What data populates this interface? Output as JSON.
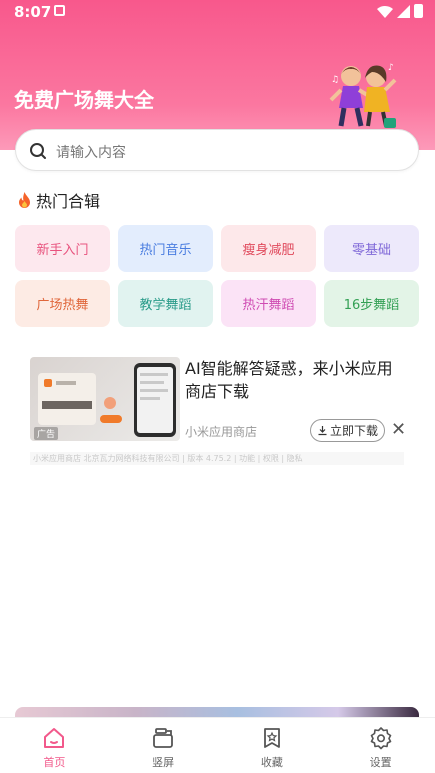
{
  "status_bar": {
    "time": "8:07"
  },
  "header": {
    "title": "免费广场舞大全"
  },
  "search": {
    "placeholder": "请输入内容"
  },
  "hot_section": {
    "title": "热门合辑"
  },
  "categories": [
    {
      "label": "新手入门",
      "bg": "#fde8ee",
      "fg": "#e8537e"
    },
    {
      "label": "热门音乐",
      "bg": "#e3edfd",
      "fg": "#4a7de0"
    },
    {
      "label": "瘦身减肥",
      "bg": "#fde8ea",
      "fg": "#e0495c"
    },
    {
      "label": "零基础",
      "bg": "#ede9fb",
      "fg": "#8069d8"
    },
    {
      "label": "广场热舞",
      "bg": "#fdebe4",
      "fg": "#e0673c"
    },
    {
      "label": "教学舞蹈",
      "bg": "#e1f3f0",
      "fg": "#2b9c8a"
    },
    {
      "label": "热汗舞蹈",
      "bg": "#fbe3f6",
      "fg": "#cf4cb3"
    },
    {
      "label": "16步舞蹈",
      "bg": "#e3f4e7",
      "fg": "#34a055"
    }
  ],
  "ad": {
    "title": "AI智能解答疑惑，来小米应用商店下载",
    "source": "小米应用商店",
    "download_label": "立即下载",
    "close_symbol": "✕",
    "thumb_badge": "广告",
    "footer": "小米应用商店 北京瓦力网络科技有限公司 | 版本 4.75.2 | 功能 | 权限 | 隐私"
  },
  "bottom_nav": [
    {
      "label": "首页",
      "icon": "home-icon",
      "active": true
    },
    {
      "label": "竖屏",
      "icon": "portrait-screen-icon",
      "active": false
    },
    {
      "label": "收藏",
      "icon": "bookmark-icon",
      "active": false
    },
    {
      "label": "设置",
      "icon": "gear-icon",
      "active": false
    }
  ],
  "colors": {
    "brand_pink": "#f8588c",
    "active_nav": "#f2598b"
  }
}
